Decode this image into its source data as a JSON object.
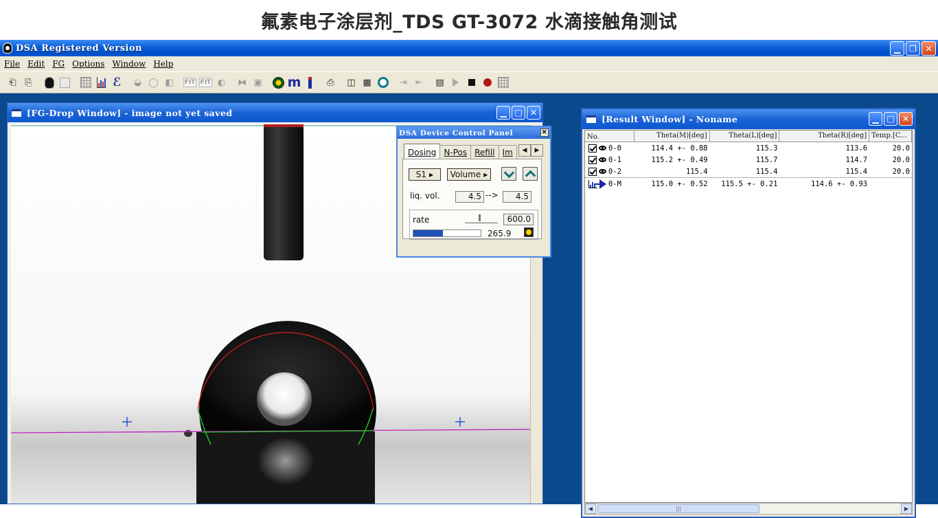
{
  "banner": {
    "title": "氟素电子涂层剂_TDS GT-3072 水滴接触角测试"
  },
  "app": {
    "title": "DSA Registered Version",
    "menu": [
      "File",
      "Edit",
      "FG",
      "Options",
      "Window",
      "Help"
    ]
  },
  "toolbar": {
    "icons": [
      "save-icon",
      "open-icon",
      "drop-icon",
      "page-icon",
      "table-icon",
      "chart-icon",
      "script-icon",
      "lens-icon",
      "circle-icon",
      "half-icon",
      "fit-icon",
      "fit-all-icon",
      "shape-icon",
      "mirror-icon",
      "camera-icon",
      "dial-icon",
      "m-icon",
      "syringe-icon",
      "print-icon",
      "video-icon",
      "capture-icon",
      "ring-icon",
      "step-forward-icon",
      "step-back-icon",
      "film-icon",
      "play-icon",
      "stop-icon",
      "record-icon",
      "grid-icon"
    ],
    "fit_label": "FIT",
    "fit_all_label": "FIT",
    "m_label": "m"
  },
  "drop_window": {
    "title": "[FG-Drop Window] - image not yet saved"
  },
  "device_panel": {
    "title": "DSA Device Control Panel",
    "tabs": [
      "Dosing",
      "N-Pos",
      "Refill",
      "Im"
    ],
    "syringe_button": "S1",
    "mode_button": "Volume",
    "liq_vol_label": "liq. vol.",
    "liq_vol_from": "4.5",
    "liq_vol_arrow": "-->",
    "liq_vol_to": "4.5",
    "rate_label": "rate",
    "rate_value": "600.0",
    "progress_value": "265.9",
    "progress_fraction": 0.44
  },
  "result_window": {
    "title": "[Result Window] - Noname",
    "columns": [
      "No.",
      "Theta(M)[deg]",
      "Theta(L)[deg]",
      "Theta(R)[deg]",
      "Temp.[C..."
    ],
    "rows": [
      {
        "no": "0-0",
        "theta_m": "114.4 +- 0.88",
        "theta_l": "115.3",
        "theta_r": "113.6",
        "temp": "20.0",
        "kind": "measurement"
      },
      {
        "no": "0-1",
        "theta_m": "115.2 +- 0.49",
        "theta_l": "115.7",
        "theta_r": "114.7",
        "temp": "20.0",
        "kind": "measurement"
      },
      {
        "no": "0-2",
        "theta_m": "115.4",
        "theta_l": "115.4",
        "theta_r": "115.4",
        "temp": "20.0",
        "kind": "measurement"
      },
      {
        "no": "0-M",
        "theta_m": "115.0 +- 0.52",
        "theta_l": "115.5 +- 0.21",
        "theta_r": "114.6 +- 0.93",
        "temp": "",
        "kind": "mean"
      }
    ]
  },
  "colors": {
    "titlebar_blue": "#0a5fd8",
    "desktop_blue": "#0a4a8c",
    "fit_line_red": "#d02020",
    "baseline_magenta": "#c020c0",
    "tangent_green": "#20c020"
  }
}
